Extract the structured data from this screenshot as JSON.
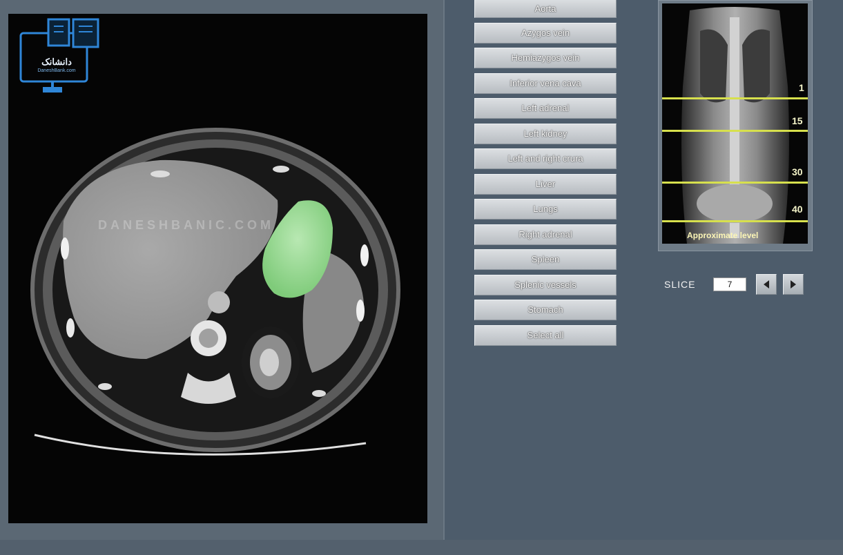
{
  "watermark": "DANESHBANIC.COM",
  "logo": {
    "text": "دانشانک",
    "subtext": "DaneshBank.com"
  },
  "structures": [
    "Aorta",
    "Azygos vein",
    "Hemiazygos vein",
    "Inferior vena cava",
    "Left adrenal",
    "Left kidney",
    "Left and right crura",
    "Liver",
    "Lungs",
    "Right adrenal",
    "Spleen",
    "Splenic vessels",
    "Stomach",
    "Select all"
  ],
  "scout": {
    "levels": [
      "1",
      "15",
      "30",
      "40"
    ],
    "approx_label": "Approximate level"
  },
  "slice": {
    "label": "SLICE",
    "value": "7",
    "prev_icon": "triangle-left-icon",
    "next_icon": "triangle-right-icon"
  },
  "colors": {
    "highlight": "#8fd48a",
    "level_line": "#d7e04d",
    "background": "#4d5c6b"
  }
}
